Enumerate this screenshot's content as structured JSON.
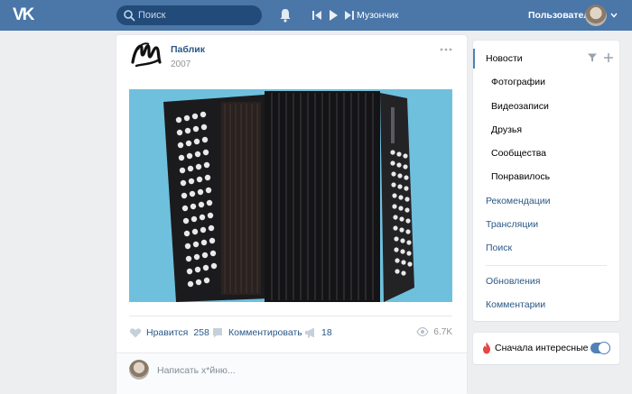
{
  "header": {
    "logo_text": "VK",
    "search_placeholder": "Поиск",
    "track": "Музончик",
    "user_name": "Пользователь"
  },
  "post": {
    "author": "Паблик",
    "date": "2007",
    "likes_label": "Нравится",
    "likes_count": "258",
    "comment_label": "Комментировать",
    "reposts_count": "18",
    "views": "6.7K",
    "comment_placeholder": "Написать х*йню..."
  },
  "menu": {
    "items": [
      {
        "label": "Новости"
      },
      {
        "label": "Фотографии"
      },
      {
        "label": "Видеозаписи"
      },
      {
        "label": "Друзья"
      },
      {
        "label": "Сообщества"
      },
      {
        "label": "Понравилось"
      },
      {
        "label": "Рекомендации"
      },
      {
        "label": "Трансляции"
      },
      {
        "label": "Поиск"
      },
      {
        "label": "Обновления"
      },
      {
        "label": "Комментарии"
      }
    ]
  },
  "toggle": {
    "label": "Сначала интересные",
    "enabled": true
  },
  "colors": {
    "header_bg": "#4a76a8",
    "link": "#2a5885",
    "accent": "#5181b8",
    "image_bg": "#6fc0dd"
  }
}
